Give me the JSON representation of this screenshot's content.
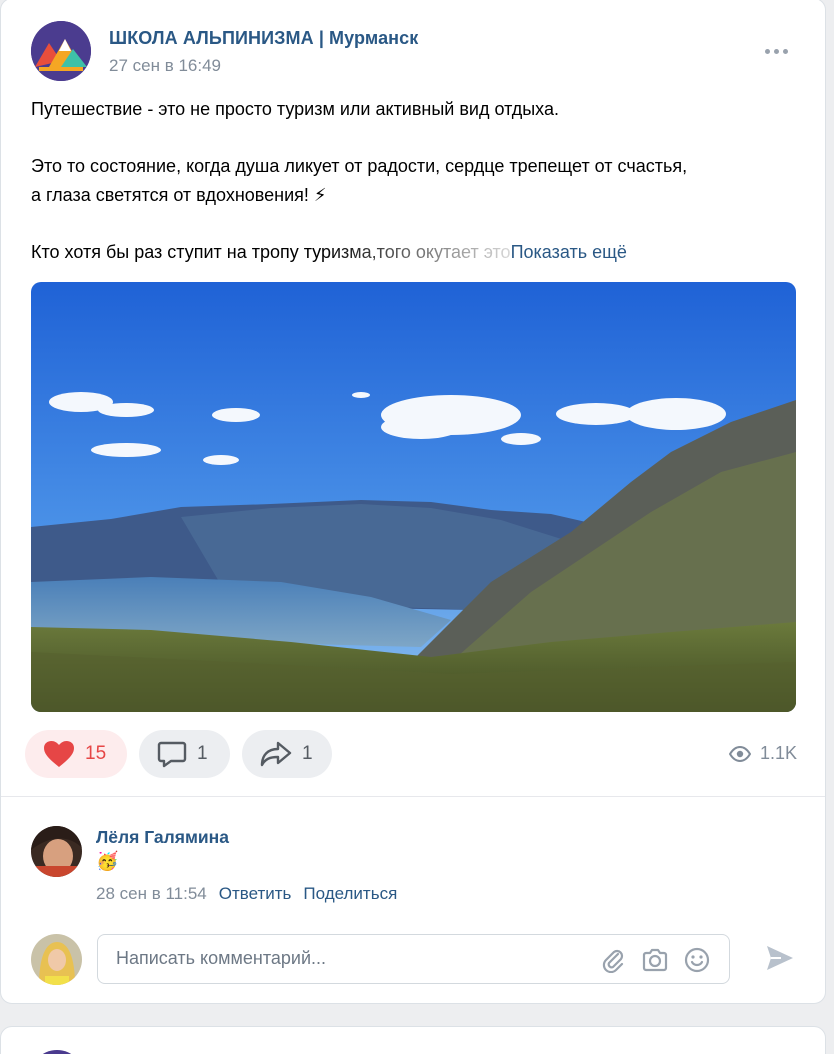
{
  "post": {
    "group_name": "ШКОЛА АЛЬПИНИЗМА | Мурманск",
    "date": "27 сен в 16:49",
    "text_line1": "Путешествие - это не просто туризм или активный вид отдыха.",
    "text_line2": "Это то состояние, когда душа ликует от радости, сердце трепещет от счастья,",
    "text_line3": "а глаза светятся от вдохновения! ⚡",
    "text_line4": "Кто хотя бы раз ступит на тропу туризма,того окутает это",
    "show_more": "Показать ещё",
    "likes": "15",
    "comments": "1",
    "shares": "1",
    "views": "1.1K"
  },
  "comment": {
    "author": "Лёля Галямина",
    "text": "🥳",
    "date": "28 сен в 11:54",
    "reply_label": "Ответить",
    "share_label": "Поделиться"
  },
  "composer": {
    "placeholder": "Написать комментарий..."
  },
  "colors": {
    "link": "#2a5885",
    "like": "#e64646",
    "muted": "#818c99"
  },
  "icons": [
    "more-icon",
    "heart-icon",
    "comment-icon",
    "share-icon",
    "eye-icon",
    "paperclip-icon",
    "camera-icon",
    "smile-icon",
    "send-icon"
  ]
}
